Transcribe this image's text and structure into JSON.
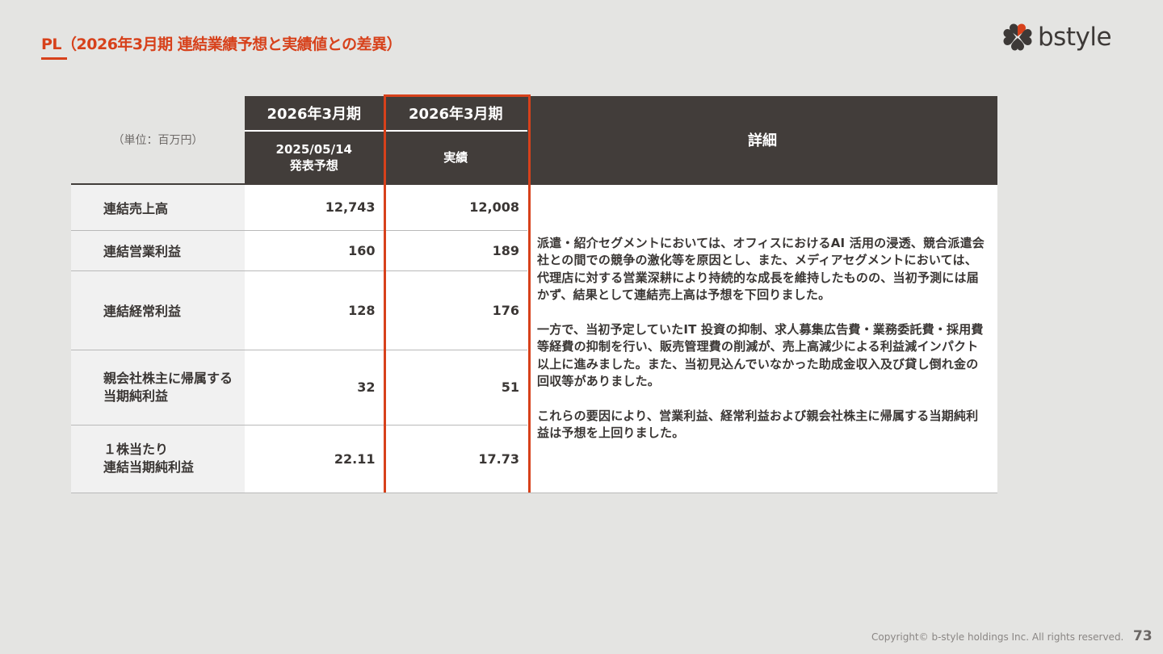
{
  "header": {
    "title_prefix": "PL",
    "title_rest": "（2026年3月期 連結業績予想と実績値との差異）"
  },
  "logo": {
    "text": "bstyle",
    "icon": "four-heart-clover-icon",
    "color": "#3d3937"
  },
  "table": {
    "unit_label": "（単位：百万円）",
    "col1_period": "2026年3月期",
    "col1_sub": "2025/05/14\n発表予想",
    "col2_period": "2026年3月期",
    "col2_sub": "実績",
    "detail_header": "詳細",
    "rows": [
      {
        "label": "連結売上高",
        "forecast": "12,743",
        "actual": "12,008"
      },
      {
        "label": "連結営業利益",
        "forecast": "160",
        "actual": "189"
      },
      {
        "label": "連結経常利益",
        "forecast": "128",
        "actual": "176"
      },
      {
        "label": "親会社株主に帰属する\n当期純利益",
        "forecast": "32",
        "actual": "51"
      },
      {
        "label": "１株当たり\n連結当期純利益",
        "forecast": "22.11",
        "actual": "17.73"
      }
    ],
    "detail_paragraphs": [
      "派遣・紹介セグメントにおいては、オフィスにおけるAI 活用の浸透、競合派遣会社との間での競争の激化等を原因とし、また、メディアセグメントにおいては、代理店に対する営業深耕により持続的な成長を維持したものの、当初予測には届かず、結果として連結売上高は予想を下回りました。",
      "一方で、当初予定していたIT 投資の抑制、求人募集広告費・業務委託費・採用費等経費の抑制を行い、販売管理費の削減が、売上高減少による利益減インパクト以上に進みました。また、当初見込んでいなかった助成金収入及び貸し倒れ金の回収等がありました。",
      "これらの要因により、営業利益、経常利益および親会社株主に帰属する当期純利益は予想を上回りました。"
    ]
  },
  "colors": {
    "accent": "#d7411b",
    "header_bg": "#423d3a",
    "page_bg": "#e4e4e2"
  },
  "footer": {
    "copyright": "Copyright© b-style holdings Inc. All rights reserved.",
    "page_number": "73"
  }
}
